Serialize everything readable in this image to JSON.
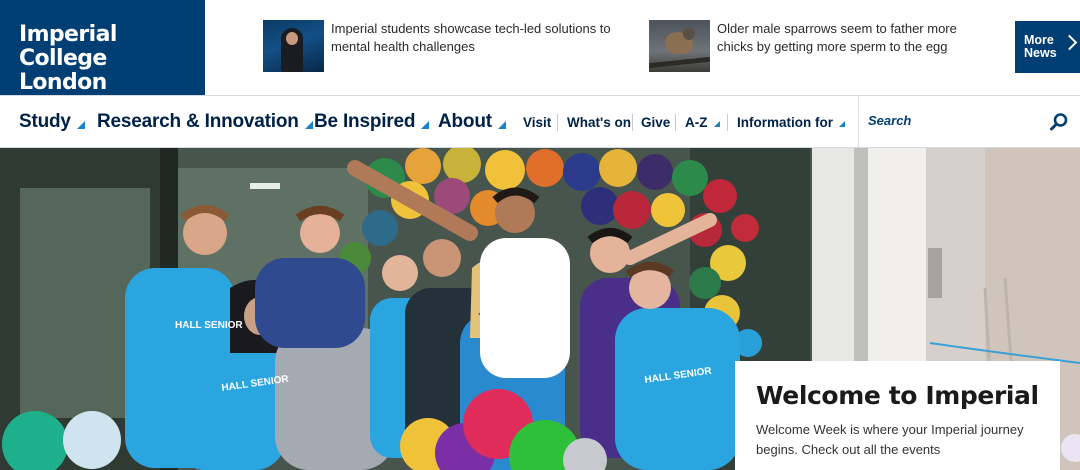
{
  "logo": {
    "line1": "Imperial College",
    "line2": "London"
  },
  "news": [
    {
      "text": "Imperial students showcase tech-led solutions to mental health challenges",
      "thumb": "students-presenting-photo"
    },
    {
      "text": "Older male sparrows seem to father more chicks by getting more sperm to the egg",
      "thumb": "sparrow-photo"
    }
  ],
  "more_news": {
    "line1": "More",
    "line2": "News"
  },
  "nav": {
    "primary": [
      {
        "label": "Study"
      },
      {
        "label": "Research & Innovation"
      },
      {
        "label": "Be Inspired"
      },
      {
        "label": "About"
      }
    ],
    "secondary": [
      {
        "label": "Visit"
      },
      {
        "label": "What's on"
      },
      {
        "label": "Give"
      },
      {
        "label": "A-Z"
      },
      {
        "label": "Information for"
      }
    ]
  },
  "search": {
    "placeholder": "Search"
  },
  "hero": {
    "welcome_title": "Welcome to Imperial",
    "welcome_text": "Welcome Week is where your Imperial journey begins. Check out all the events",
    "shirt_text": "HALL SENIOR"
  },
  "colors": {
    "brand_navy": "#003e74",
    "accent_blue": "#1583c5",
    "shirt_blue": "#2aa5e0"
  }
}
